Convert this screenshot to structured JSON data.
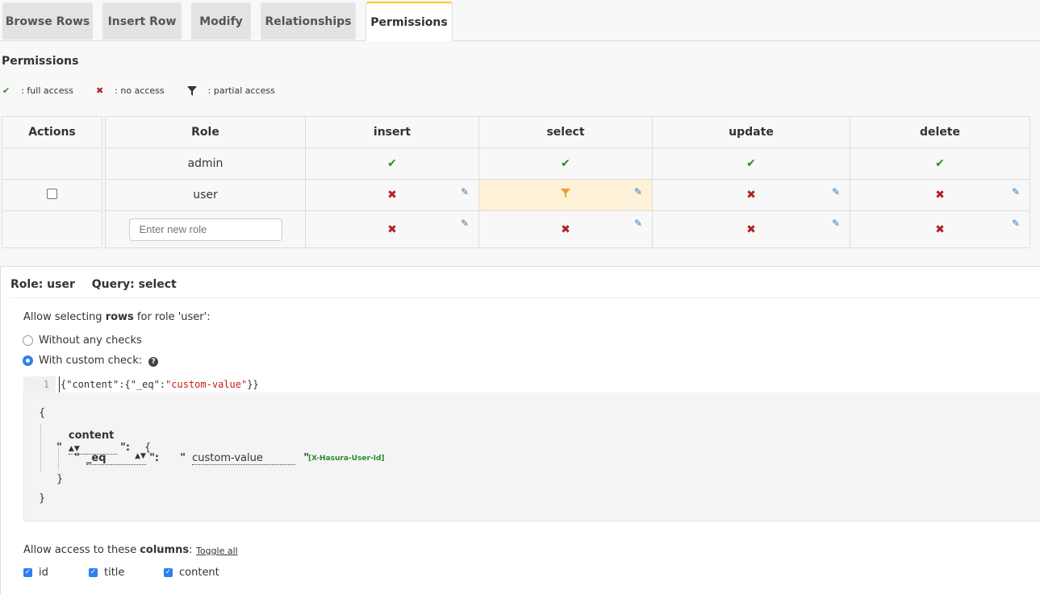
{
  "tabs": [
    {
      "label": "Browse Rows"
    },
    {
      "label": "Insert Row"
    },
    {
      "label": "Modify"
    },
    {
      "label": "Relationships"
    },
    {
      "label": "Permissions",
      "active": true
    }
  ],
  "permissions": {
    "title": "Permissions",
    "legend": {
      "full": ": full access",
      "none": ": no access",
      "partial": ": partial access"
    },
    "headers": [
      "Actions",
      "Role",
      "insert",
      "select",
      "update",
      "delete"
    ],
    "rows": [
      {
        "role": "admin",
        "insert": "full",
        "select": "full",
        "update": "full",
        "delete": "full"
      },
      {
        "role": "user",
        "insert": "none",
        "select": "partial",
        "update": "none",
        "delete": "none"
      }
    ],
    "new_role_placeholder": "Enter new role"
  },
  "panel": {
    "role_label": "Role: user",
    "query_label": "Query: select",
    "allow_prefix": "Allow selecting ",
    "allow_bold": "rows",
    "allow_suffix": " for role 'user':",
    "option_without": "Without any checks",
    "option_custom": "With custom check:",
    "editor_line": "1",
    "editor_code_open": "{\"content\":{\"_eq\":",
    "editor_code_value": "\"custom-value\"",
    "editor_code_close": "}}",
    "builder": {
      "open_brace": "{",
      "column": "content",
      "operator": "_eq",
      "value": "custom-value",
      "session_var": "[X-Hasura-User-Id]",
      "close_inner": "}",
      "close_outer": "}"
    },
    "columns_prefix": "Allow access to these ",
    "columns_bold": "columns",
    "columns_suffix": ":",
    "toggle_all": "Toggle all",
    "columns": [
      "id",
      "title",
      "content"
    ]
  }
}
